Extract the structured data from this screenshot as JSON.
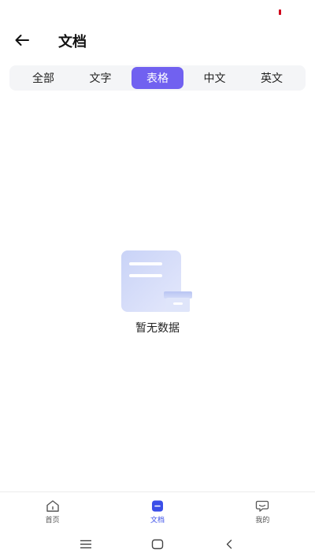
{
  "header": {
    "title": "文档"
  },
  "tabs": [
    {
      "label": "全部"
    },
    {
      "label": "文字"
    },
    {
      "label": "表格",
      "active": true
    },
    {
      "label": "中文"
    },
    {
      "label": "英文"
    }
  ],
  "empty": {
    "text": "暂无数据"
  },
  "bottom_nav": [
    {
      "label": "首页",
      "icon": "home-icon"
    },
    {
      "label": "文档",
      "icon": "document-icon",
      "active": true
    },
    {
      "label": "我的",
      "icon": "chat-bubble-icon"
    }
  ],
  "system_nav": {
    "icons": [
      "menu-icon",
      "home-square-icon",
      "back-chevron-icon"
    ]
  },
  "colors": {
    "accent": "#7161f0",
    "nav_active": "#3a4ee8",
    "tab_bg": "#f4f5f7"
  }
}
